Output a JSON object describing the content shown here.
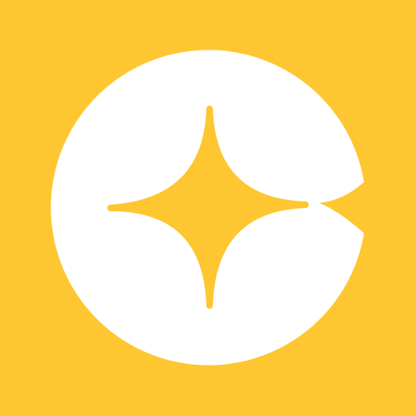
{
  "icon": {
    "name": "sparkle-c-logo",
    "colors": {
      "background": "#FEC630",
      "circle": "#FFFFFF",
      "sparkle": "#FEC630"
    }
  }
}
